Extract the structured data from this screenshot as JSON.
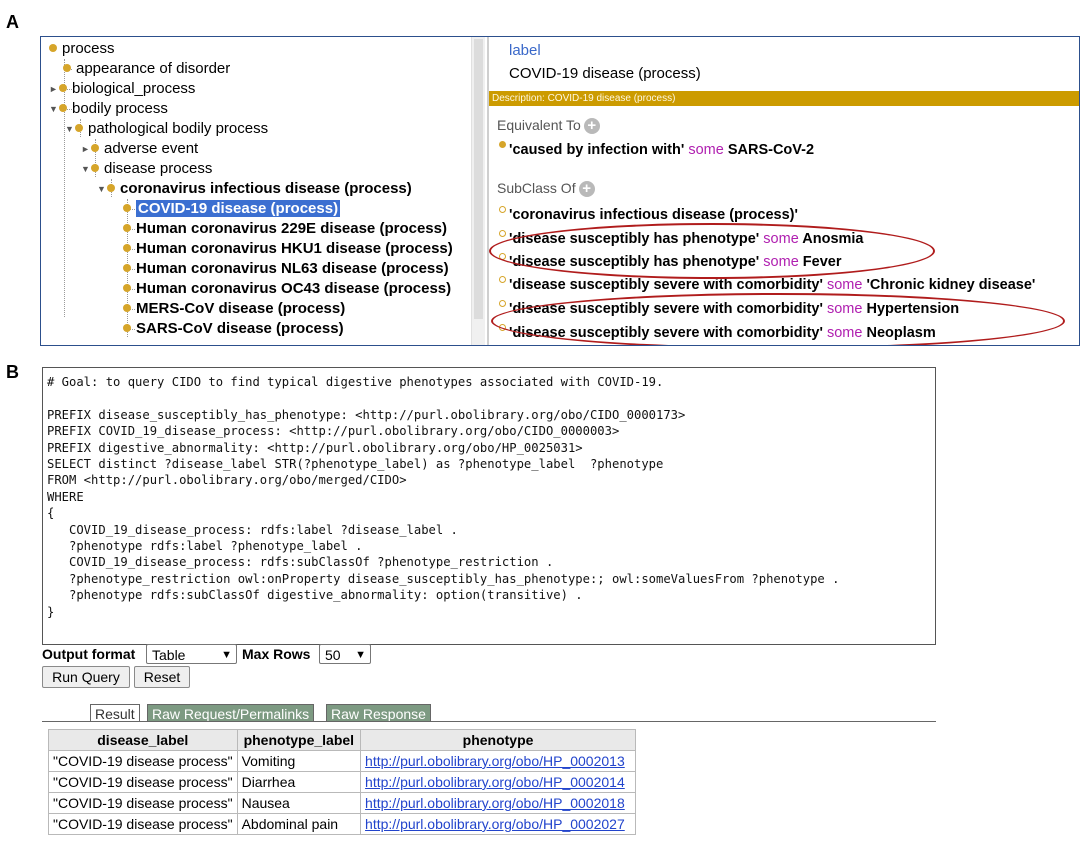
{
  "panel_letters": {
    "a": "A",
    "b": "B"
  },
  "tree": {
    "items": [
      {
        "label": "process"
      },
      {
        "label": "appearance of disorder"
      },
      {
        "label": "biological_process"
      },
      {
        "label": "bodily process"
      },
      {
        "label": "pathological bodily process"
      },
      {
        "label": "adverse event"
      },
      {
        "label": "disease process"
      },
      {
        "label": "coronavirus infectious disease (process)"
      },
      {
        "label": "COVID-19 disease (process)"
      },
      {
        "label": "Human coronavirus 229E disease (process)"
      },
      {
        "label": "Human coronavirus HKU1 disease (process)"
      },
      {
        "label": "Human coronavirus NL63 disease (process)"
      },
      {
        "label": "Human coronavirus OC43 disease (process)"
      },
      {
        "label": "MERS-CoV disease (process)"
      },
      {
        "label": "SARS-CoV disease (process)"
      }
    ]
  },
  "description": {
    "label_heading": "label",
    "label_value": "COVID-19 disease (process)",
    "bar_text": "Description: COVID-19 disease (process)",
    "equivalent_heading": "Equivalent To",
    "equivalent": {
      "left": "'caused by infection with'",
      "kw": "some",
      "right": "SARS-CoV-2"
    },
    "subclass_heading": "SubClass Of",
    "subclass_parent": "'coronavirus infectious disease (process)'",
    "subclass_axioms": [
      {
        "left": "'disease susceptibly has phenotype'",
        "kw": "some",
        "right": "Anosmia"
      },
      {
        "left": "'disease susceptibly has phenotype'",
        "kw": "some",
        "right": "Fever"
      },
      {
        "left": "'disease susceptibly severe with comorbidity'",
        "kw": "some",
        "right": "'Chronic kidney disease'"
      },
      {
        "left": "'disease susceptibly severe with comorbidity'",
        "kw": "some",
        "right": "Hypertension"
      },
      {
        "left": "'disease susceptibly severe with comorbidity'",
        "kw": "some",
        "right": "Neoplasm"
      }
    ]
  },
  "query": {
    "text": "# Goal: to query CIDO to find typical digestive phenotypes associated with COVID-19.\n\nPREFIX disease_susceptibly_has_phenotype: <http://purl.obolibrary.org/obo/CIDO_0000173>\nPREFIX COVID_19_disease_process: <http://purl.obolibrary.org/obo/CIDO_0000003>\nPREFIX digestive_abnormality: <http://purl.obolibrary.org/obo/HP_0025031>\nSELECT distinct ?disease_label STR(?phenotype_label) as ?phenotype_label  ?phenotype\nFROM <http://purl.obolibrary.org/obo/merged/CIDO>\nWHERE\n{\n   COVID_19_disease_process: rdfs:label ?disease_label .\n   ?phenotype rdfs:label ?phenotype_label .\n   COVID_19_disease_process: rdfs:subClassOf ?phenotype_restriction .\n   ?phenotype_restriction owl:onProperty disease_susceptibly_has_phenotype:; owl:someValuesFrom ?phenotype .\n   ?phenotype rdfs:subClassOf digestive_abnormality: option(transitive) .\n}"
  },
  "controls": {
    "output_format_label": "Output format",
    "output_format_value": "Table",
    "max_rows_label": "Max Rows",
    "max_rows_value": "50",
    "run_query": "Run Query",
    "reset": "Reset"
  },
  "tabs": {
    "result": "Result",
    "raw_request": "Raw Request/Permalinks",
    "raw_response": "Raw Response"
  },
  "results": {
    "headers": [
      "disease_label",
      "phenotype_label",
      "phenotype"
    ],
    "rows": [
      [
        "\"COVID-19 disease process\"",
        "Vomiting",
        "http://purl.obolibrary.org/obo/HP_0002013"
      ],
      [
        "\"COVID-19 disease process\"",
        "Diarrhea",
        "http://purl.obolibrary.org/obo/HP_0002014"
      ],
      [
        "\"COVID-19 disease process\"",
        "Nausea",
        "http://purl.obolibrary.org/obo/HP_0002018"
      ],
      [
        "\"COVID-19 disease process\"",
        "Abdominal pain",
        "http://purl.obolibrary.org/obo/HP_0002027"
      ]
    ]
  },
  "colors": {
    "owl_keyword": "#b020b0",
    "ellipse": "#b01c1c",
    "gold": "#cc9b00",
    "selection": "#3b6fd1",
    "tab_inactive": "#7d9a82"
  }
}
